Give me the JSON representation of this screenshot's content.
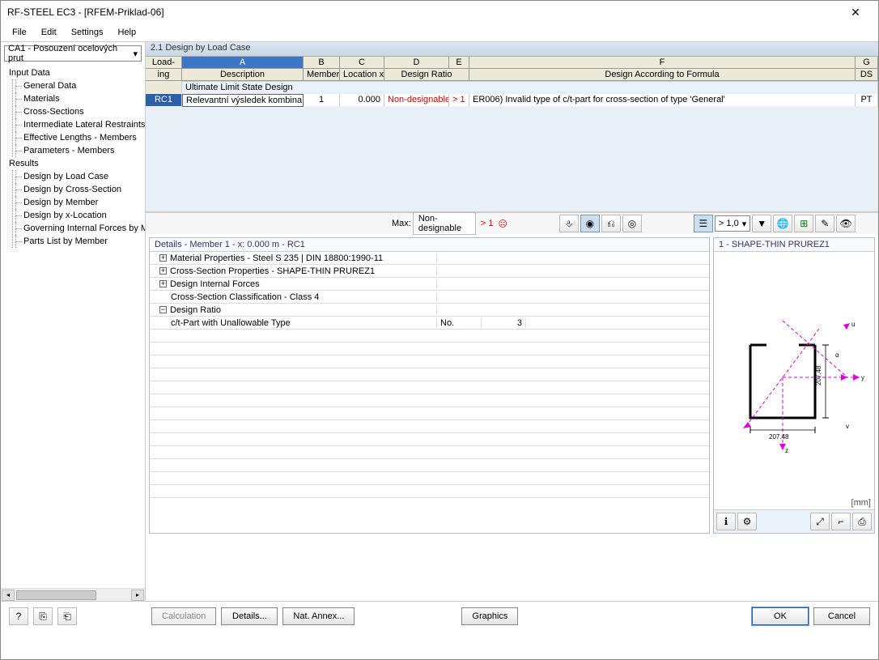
{
  "window": {
    "title": "RF-STEEL EC3 - [RFEM-Priklad-06]"
  },
  "menubar": {
    "file": "File",
    "edit": "Edit",
    "settings": "Settings",
    "help": "Help"
  },
  "combo": {
    "selected": "CA1 - Posouzení ocelových prut"
  },
  "tree": {
    "input_data": "Input Data",
    "general_data": "General Data",
    "materials": "Materials",
    "cross_sections": "Cross-Sections",
    "ilr": "Intermediate Lateral Restraints",
    "eff_len": "Effective Lengths - Members",
    "params": "Parameters - Members",
    "results": "Results",
    "by_loadcase": "Design by Load Case",
    "by_cs": "Design by Cross-Section",
    "by_member": "Design by Member",
    "by_xloc": "Design by x-Location",
    "gov_forces": "Governing Internal Forces by M",
    "parts_list": "Parts List by Member"
  },
  "panel": {
    "title": "2.1 Design by Load Case"
  },
  "grid": {
    "col_loading": "Load-",
    "col_loading2": "ing",
    "col_A": "A",
    "col_B": "B",
    "col_C": "C",
    "col_D": "D",
    "col_E": "E",
    "col_F": "F",
    "col_G": "G",
    "sub_desc": "Description",
    "sub_member": "Member No.",
    "sub_loc": "Location x [m]",
    "sub_design": "Design Ratio",
    "sub_formula": "Design According to Formula",
    "sub_ds": "DS",
    "group_row": "Ultimate Limit State Design",
    "row": {
      "id": "RC1",
      "desc": "Relevantní výsledek kombina",
      "member": "1",
      "x": "0.000",
      "ratio": "Non-designable",
      "gt": "> 1",
      "formula": "ER006) Invalid type of c/t-part for cross-section of type 'General'",
      "ds": "PT"
    }
  },
  "toolstrip": {
    "max_label": "Max:",
    "max_val": "Non-designable",
    "gt": "> 1",
    "ratio_combo": "> 1,0"
  },
  "details": {
    "title": "Details - Member 1 - x: 0.000 m - RC1",
    "mat_props": "Material Properties - Steel S 235 | DIN 18800:1990-11",
    "cs_props": "Cross-Section Properties  -  SHAPE-THIN PRUREZ1",
    "design_forces": "Design Internal Forces",
    "cs_class": "Cross-Section Classification - Class 4",
    "design_ratio": "Design Ratio",
    "ct_part": "c/t-Part with Unallowable Type",
    "no_label": "No.",
    "no_val": "3"
  },
  "preview": {
    "title": "1 - SHAPE-THIN PRUREZ1",
    "units": "[mm]",
    "dim_w": "207.48",
    "dim_h": "207.48"
  },
  "buttons": {
    "calculation": "Calculation",
    "details": "Details...",
    "nat_annex": "Nat. Annex...",
    "graphics": "Graphics",
    "ok": "OK",
    "cancel": "Cancel"
  }
}
